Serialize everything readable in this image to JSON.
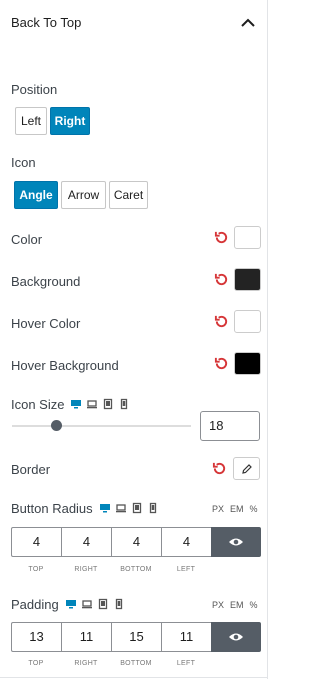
{
  "section": {
    "title": "Back To Top"
  },
  "position": {
    "label": "Position",
    "options": [
      "Left",
      "Right"
    ],
    "selected": "Right"
  },
  "icon": {
    "label": "Icon",
    "options": [
      "Angle",
      "Arrow",
      "Caret"
    ],
    "selected": "Angle"
  },
  "colors": [
    {
      "label": "Color",
      "value": "#ffffff"
    },
    {
      "label": "Background",
      "value": "#232323"
    },
    {
      "label": "Hover Color",
      "value": "#ffffff"
    },
    {
      "label": "Hover Background",
      "value": "#000000"
    }
  ],
  "icon_size": {
    "label": "Icon Size",
    "value": "18",
    "slider_fraction": 0.24
  },
  "border": {
    "label": "Border"
  },
  "button_radius": {
    "label": "Button Radius",
    "units": [
      "PX",
      "EM",
      "%"
    ],
    "values": [
      "4",
      "4",
      "4",
      "4"
    ],
    "sides": [
      "TOP",
      "RIGHT",
      "BOTTOM",
      "LEFT"
    ]
  },
  "padding": {
    "label": "Padding",
    "units": [
      "PX",
      "EM",
      "%"
    ],
    "values": [
      "13",
      "11",
      "15",
      "11"
    ],
    "sides": [
      "TOP",
      "RIGHT",
      "BOTTOM",
      "LEFT"
    ]
  },
  "theme": {
    "accent": "#0085ba",
    "reset_red": "#d63638",
    "device_blue": "#0085ba"
  }
}
